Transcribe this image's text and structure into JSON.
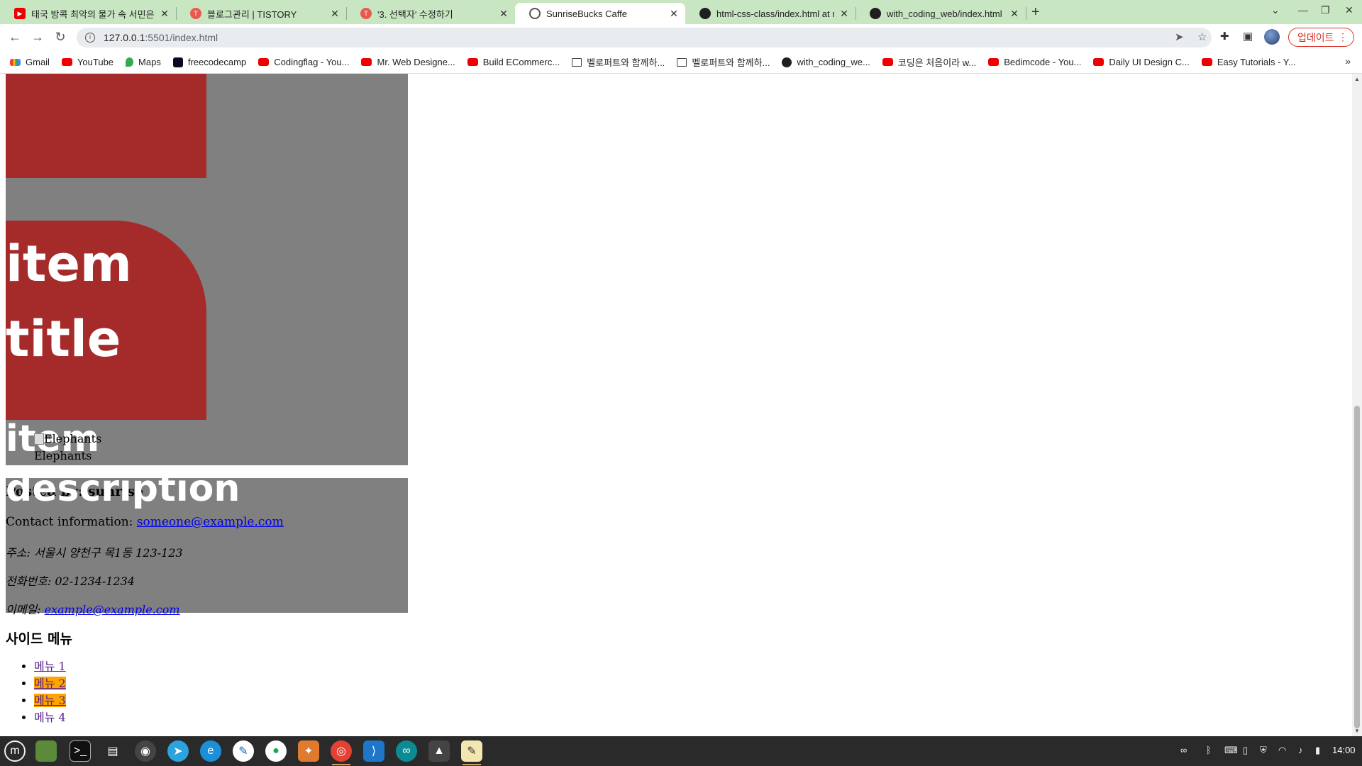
{
  "tabs": [
    {
      "title": "태국 방콕 최악의 물가 속 서민은",
      "favicon": "youtube-icon"
    },
    {
      "title": "블로그관리 | TISTORY",
      "favicon": "tistory-icon"
    },
    {
      "title": "'3. 선택자' 수정하기",
      "favicon": "tistory-icon"
    },
    {
      "title": "SunriseBucks Caffe",
      "favicon": "globe-icon"
    },
    {
      "title": "html-css-class/index.html at m",
      "favicon": "github-icon"
    },
    {
      "title": "with_coding_web/index.html",
      "favicon": "github-icon"
    }
  ],
  "address": {
    "host": "127.0.0.1",
    "path": ":5501/index.html"
  },
  "update_label": "업데이트",
  "bookmarks": [
    {
      "label": "Gmail",
      "icon": "gmail-icon"
    },
    {
      "label": "YouTube",
      "icon": "youtube-icon"
    },
    {
      "label": "Maps",
      "icon": "maps-icon"
    },
    {
      "label": "freecodecamp",
      "icon": "freecodecamp-icon"
    },
    {
      "label": "Codingflag - You...",
      "icon": "youtube-icon"
    },
    {
      "label": "Mr. Web Designe...",
      "icon": "youtube-icon"
    },
    {
      "label": "Build ECommerc...",
      "icon": "youtube-icon"
    },
    {
      "label": "벨로퍼트와 함께하...",
      "icon": "book-icon"
    },
    {
      "label": "벨로퍼트와 함께하...",
      "icon": "book-icon"
    },
    {
      "label": "with_coding_we...",
      "icon": "github-icon"
    },
    {
      "label": "코딩은 처음이라 w...",
      "icon": "youtube-icon"
    },
    {
      "label": "Bedimcode - You...",
      "icon": "youtube-icon"
    },
    {
      "label": "Daily UI Design C...",
      "icon": "youtube-icon"
    },
    {
      "label": "Easy Tutorials - Y...",
      "icon": "youtube-icon"
    }
  ],
  "page": {
    "item_title_line1": "item",
    "item_title_line2": "title",
    "item_desc_line1": "item",
    "item_desc_line2": "description",
    "image_alt": "Elephants",
    "figcaption": "Elephants",
    "posted_by": "Posted by: sunrise",
    "contact_label": "Contact information: ",
    "contact_email": "someone@example.com",
    "address_line": "주소: 서울시 양천구 목1동 123-123",
    "phone_line": "전화번호: 02-1234-1234",
    "email_label": "이메일: ",
    "email_link": "example@example.com",
    "side_title": "사이드 메뉴",
    "side_menu": [
      "메뉴 1",
      "메뉴 2",
      "메뉴 3",
      "메뉴 4"
    ]
  },
  "taskbar": {
    "clock": "14:00"
  },
  "colors": {
    "card_gray": "#808080",
    "card_red": "#a52a2a",
    "highlight": "#ffa500",
    "tab_strip": "#c9e6c3"
  }
}
